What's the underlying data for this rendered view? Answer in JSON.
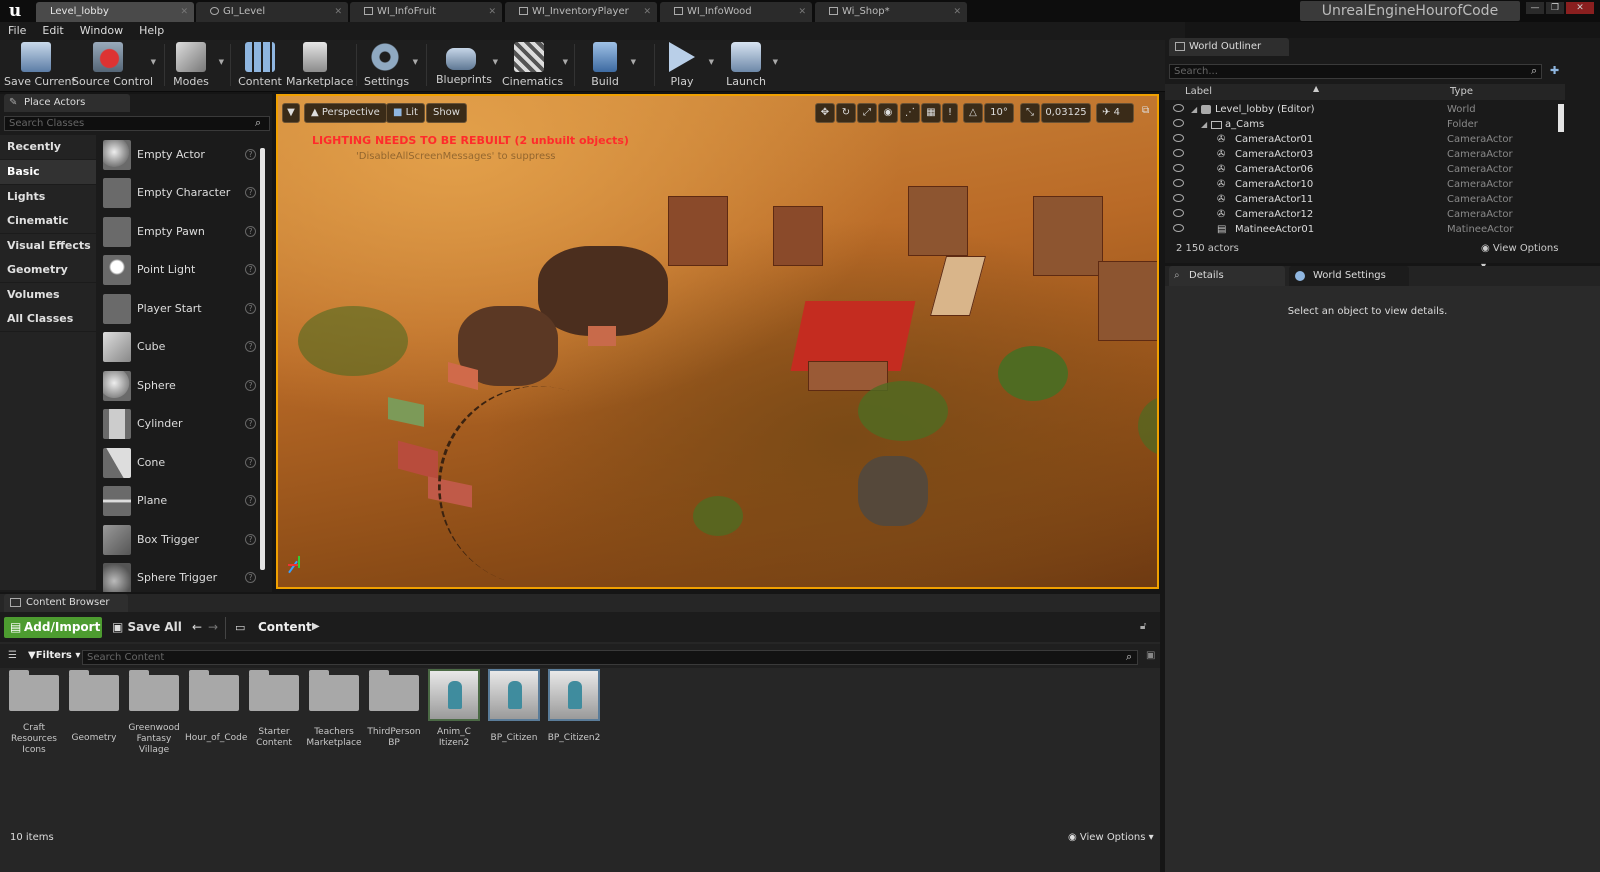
{
  "title_tabs": [
    {
      "label": "Level_lobby",
      "active": true
    },
    {
      "label": "GI_Level",
      "active": false
    },
    {
      "label": "WI_InfoFruit",
      "active": false
    },
    {
      "label": "WI_InventoryPlayer",
      "active": false
    },
    {
      "label": "WI_InfoWood",
      "active": false
    },
    {
      "label": "Wi_Shop*",
      "active": false
    }
  ],
  "project_name": "UnrealEngineHourofCode",
  "menu": {
    "file": "File",
    "edit": "Edit",
    "window": "Window",
    "help": "Help"
  },
  "toolbar": {
    "save_current": "Save Current",
    "source_control": "Source Control",
    "modes": "Modes",
    "content": "Content",
    "marketplace": "Marketplace",
    "settings": "Settings",
    "blueprints": "Blueprints",
    "cinematics": "Cinematics",
    "build": "Build",
    "play": "Play",
    "launch": "Launch"
  },
  "place_actors": {
    "tab": "Place Actors",
    "search_placeholder": "Search Classes",
    "categories": [
      "Recently Placed",
      "Basic",
      "Lights",
      "Cinematic",
      "Visual Effects",
      "Geometry",
      "Volumes",
      "All Classes"
    ],
    "selected_category": "Basic",
    "actors": [
      "Empty Actor",
      "Empty Character",
      "Empty Pawn",
      "Point Light",
      "Player Start",
      "Cube",
      "Sphere",
      "Cylinder",
      "Cone",
      "Plane",
      "Box Trigger",
      "Sphere Trigger"
    ]
  },
  "viewport": {
    "perspective": "Perspective",
    "lit": "Lit",
    "show": "Show",
    "warning": "LIGHTING NEEDS TO BE REBUILT (2 unbuilt objects)",
    "warning_sub": "'DisableAllScreenMessages' to suppress",
    "rotation_snap": "10°",
    "scale_snap": "0,03125",
    "camera_speed": "4"
  },
  "outliner": {
    "tab": "World Outliner",
    "search_placeholder": "Search...",
    "col_label": "Label",
    "col_type": "Type",
    "rows": [
      {
        "label": "Level_lobby (Editor)",
        "type": "World"
      },
      {
        "label": "a_Cams",
        "type": "Folder"
      },
      {
        "label": "CameraActor01",
        "type": "CameraActor"
      },
      {
        "label": "CameraActor03",
        "type": "CameraActor"
      },
      {
        "label": "CameraActor06",
        "type": "CameraActor"
      },
      {
        "label": "CameraActor10",
        "type": "CameraActor"
      },
      {
        "label": "CameraActor11",
        "type": "CameraActor"
      },
      {
        "label": "CameraActor12",
        "type": "CameraActor"
      },
      {
        "label": "MatineeActor01",
        "type": "MatineeActor"
      }
    ],
    "count": "2 150 actors",
    "view_options": "View Options"
  },
  "details": {
    "tab_details": "Details",
    "tab_world": "World Settings",
    "empty_msg": "Select an object to view details."
  },
  "content_browser": {
    "tab": "Content Browser",
    "add_import": "Add/Import",
    "save_all": "Save All",
    "path": "Content",
    "filters": "Filters",
    "search_placeholder": "Search Content",
    "assets": [
      {
        "label": "Craft Resources Icons",
        "kind": "folder"
      },
      {
        "label": "Geometry",
        "kind": "folder"
      },
      {
        "label": "Greenwood Fantasy Village",
        "kind": "folder"
      },
      {
        "label": "Hour_of_Code",
        "kind": "folder"
      },
      {
        "label": "Starter Content",
        "kind": "folder"
      },
      {
        "label": "Teachers Marketplace",
        "kind": "folder"
      },
      {
        "label": "ThirdPerson BP",
        "kind": "folder"
      },
      {
        "label": "Anim_C Itizen2",
        "kind": "asset"
      },
      {
        "label": "BP_Citizen",
        "kind": "blueprint"
      },
      {
        "label": "BP_Citizen2",
        "kind": "blueprint"
      }
    ],
    "item_count": "10 items",
    "view_options": "View Options"
  },
  "colors": {
    "accent": "#f0a000",
    "add_button": "#4d9c30",
    "warning": "#ff2b2b"
  }
}
